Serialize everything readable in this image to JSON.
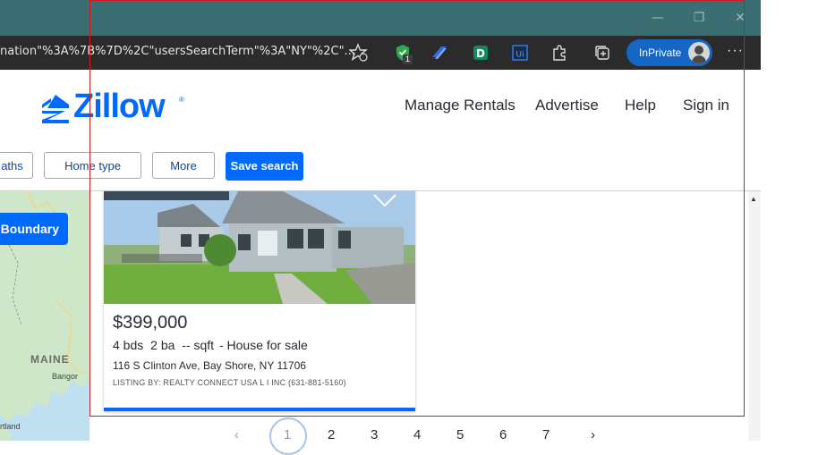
{
  "browser": {
    "url_text": "nation\"%3A%7B%7D%2C\"usersSearchTerm\"%3A\"NY\"%2C\"...",
    "inprivate_label": "InPrivate",
    "extension_badge": "1",
    "window_buttons": {
      "minimize": "—",
      "restore": "❐",
      "close": "✕"
    },
    "more_label": "···"
  },
  "header": {
    "logo_text": "Zillow",
    "nav": [
      "Manage Rentals",
      "Advertise",
      "Help",
      "Sign in"
    ]
  },
  "filters": {
    "buttons": [
      "aths",
      "Home type",
      "More"
    ],
    "save_label": "Save search"
  },
  "map": {
    "boundary_label": "Boundary",
    "labels": {
      "state": "MAINE",
      "city": "Bangor",
      "city2": "rtland"
    }
  },
  "listing": {
    "price": "$399,000",
    "beds": "4 bds",
    "baths": "2 ba",
    "sqft": "-- sqft",
    "type": "- House for sale",
    "address": "116 S Clinton Ave, Bay Shore, NY 11706",
    "listed_by": "LISTING BY: REALTY CONNECT USA L I INC (631-881-5160)"
  },
  "pagination": {
    "prev": "‹",
    "next": "›",
    "pages": [
      "1",
      "2",
      "3",
      "4",
      "5",
      "6",
      "7"
    ],
    "current": "1"
  },
  "colors": {
    "brand": "#006aff",
    "titlebar": "#3b6e73",
    "highlight": "#d11a1a"
  }
}
